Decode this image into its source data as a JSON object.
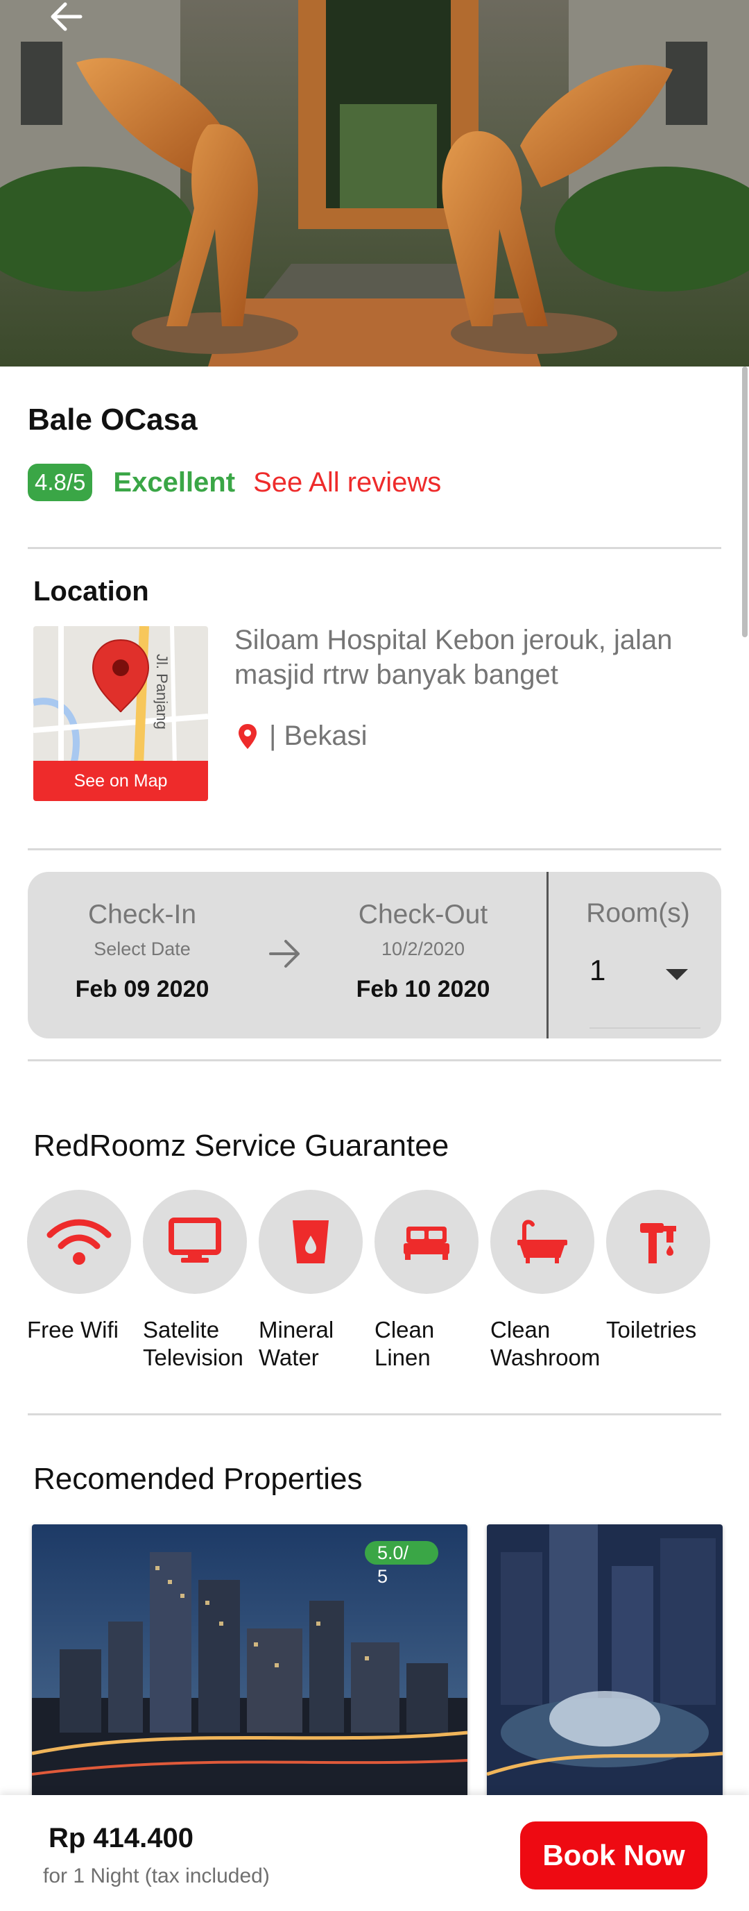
{
  "hotel": {
    "name": "Bale OCasa",
    "rating_score": "4.8/5",
    "rating_label": "Excellent",
    "reviews_link": "See All reviews"
  },
  "location": {
    "heading": "Location",
    "map_street_label": "Jl. Panjang",
    "map_button": "See on Map",
    "address": "Siloam Hospital Kebon jerouk, jalan masjid rtrw banyak banget",
    "city": "| Bekasi"
  },
  "booking": {
    "checkin_label": "Check-In",
    "checkin_sub": "Select Date",
    "checkin_date": "Feb 09 2020",
    "checkout_label": "Check-Out",
    "checkout_sub": "10/2/2020",
    "checkout_date": "Feb 10 2020",
    "rooms_label": "Room(s)",
    "rooms_value": "1"
  },
  "services": {
    "heading": "RedRoomz Service Guarantee",
    "items": [
      {
        "line1": "Free Wifi",
        "line2": "",
        "icon": "wifi-icon"
      },
      {
        "line1": "Satelite",
        "line2": "Television",
        "icon": "television-icon"
      },
      {
        "line1": "Mineral",
        "line2": "Water",
        "icon": "water-cup-icon"
      },
      {
        "line1": "Clean",
        "line2": "Linen",
        "icon": "bed-icon"
      },
      {
        "line1": "Clean",
        "line2": "Washroom",
        "icon": "bathtub-icon"
      },
      {
        "line1": "Toiletries",
        "line2": "",
        "icon": "toiletries-icon"
      }
    ]
  },
  "recommended": {
    "heading": "Recomended Properties",
    "cards": [
      {
        "rating_line1": "5.0/",
        "rating_line2": "5"
      }
    ]
  },
  "bottom_bar": {
    "price": "Rp 414.400",
    "price_note": "for 1 Night (tax included)",
    "book_button": "Book Now"
  },
  "colors": {
    "accent_red": "#ee2b2b",
    "rating_green": "#3aa646",
    "card_grey": "#dedede"
  }
}
